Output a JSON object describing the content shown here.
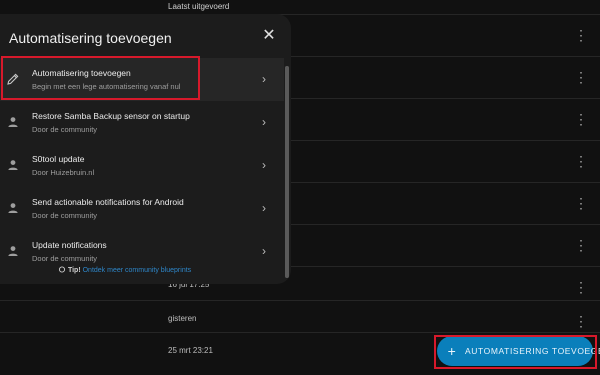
{
  "background": {
    "column_header": "Laatst uitgevoerd",
    "rows": [
      {
        "date": ""
      },
      {
        "date": ""
      },
      {
        "date": ""
      },
      {
        "date": ""
      },
      {
        "date": ""
      },
      {
        "date": ""
      },
      {
        "date": "16 jul 17:25"
      },
      {
        "date": "gisteren"
      },
      {
        "date": "25 mrt 23:21"
      }
    ],
    "more_icon": "⋮"
  },
  "dialog": {
    "title": "Automatisering toevoegen",
    "close_icon": "✕",
    "items": [
      {
        "title": "Automatisering toevoegen",
        "subtitle": "Begin met een lege automatisering vanaf nul",
        "icon": "pencil-icon"
      },
      {
        "title": "Restore Samba Backup sensor on startup",
        "subtitle": "Door de community",
        "icon": "person-icon"
      },
      {
        "title": "S0tool update",
        "subtitle": "Door Huizebruin.nl",
        "icon": "person-icon"
      },
      {
        "title": "Send actionable notifications for Android",
        "subtitle": "Door de community",
        "icon": "person-icon"
      },
      {
        "title": "Update notifications",
        "subtitle": "Door de community",
        "icon": "person-icon"
      }
    ],
    "chevron": "›",
    "tip_label": "Tip!",
    "tip_link": "Ontdek meer community blueprints"
  },
  "fab": {
    "plus": "+",
    "label": "AUTOMATISERING TOEVOEGEN"
  },
  "colors": {
    "accent": "#0a7fbb",
    "highlight": "#d7192b",
    "background": "#111111",
    "dialog": "#1c1c1c"
  }
}
